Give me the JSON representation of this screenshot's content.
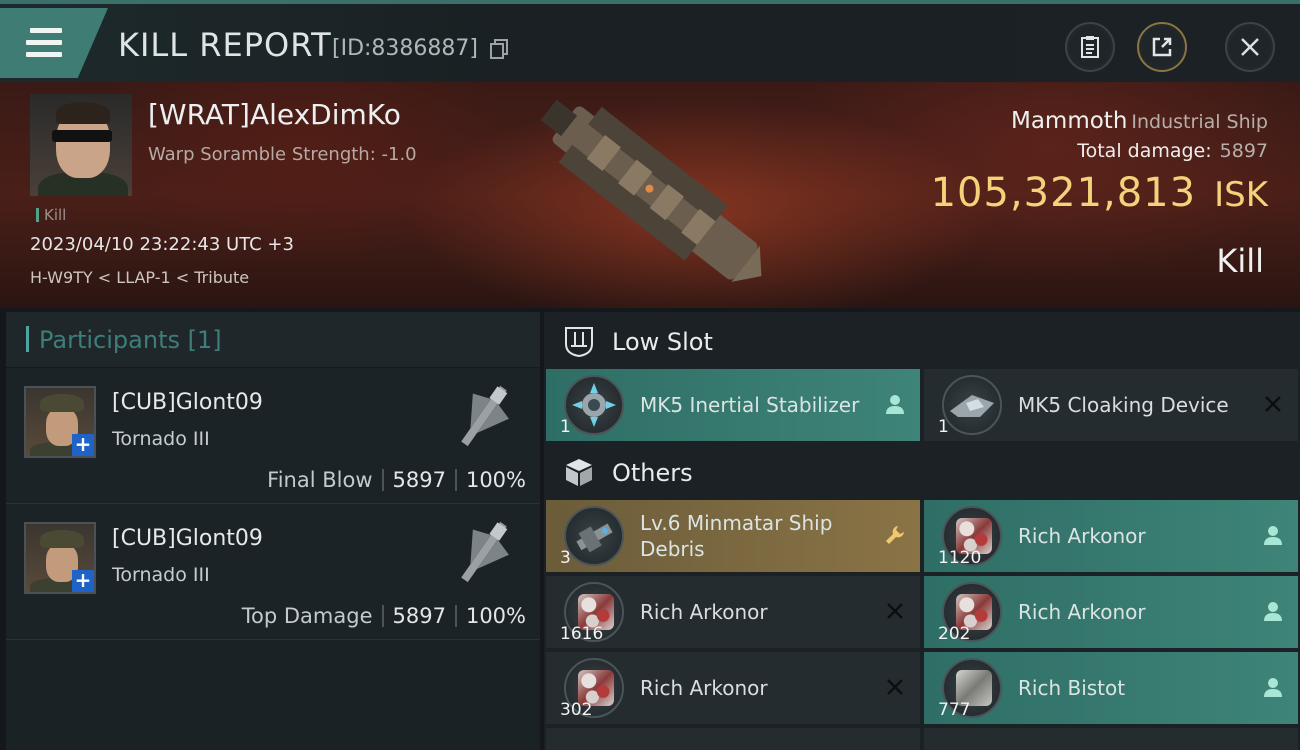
{
  "header": {
    "title": "KILL REPORT",
    "id_text": "[ID:8386887]"
  },
  "victim": {
    "name": "[WRAT]AlexDimKo",
    "warp": "Warp Soramble Strength: -1.0",
    "tag": "Kill",
    "datetime": "2023/04/10 23:22:43 UTC +3",
    "location": "H-W9TY < LLAP-1 < Tribute",
    "ship_name": "Mammoth",
    "ship_class": "Industrial Ship",
    "damage_label": "Total damage:",
    "damage_value": "5897",
    "isk_value": "105,321,813",
    "isk_unit": "ISK",
    "result": "Kill"
  },
  "participants": {
    "header": "Participants [1]",
    "rows": [
      {
        "name": "[CUB]Glont09",
        "ship": "Tornado III",
        "label": "Final Blow",
        "damage": "5897",
        "percent": "100%"
      },
      {
        "name": "[CUB]Glont09",
        "ship": "Tornado III",
        "label": "Top Damage",
        "damage": "5897",
        "percent": "100%"
      }
    ]
  },
  "fittings": {
    "low_slot": {
      "label": "Low Slot",
      "items": [
        {
          "name": "MK5 Inertial Stabilizer",
          "qty": "1",
          "state": "dropped"
        },
        {
          "name": "MK5 Cloaking Device",
          "qty": "1",
          "state": "destroyed"
        }
      ]
    },
    "others": {
      "label": "Others",
      "items": [
        {
          "name": "Lv.6 Minmatar Ship Debris",
          "qty": "3",
          "state": "salvage"
        },
        {
          "name": "Rich Arkonor",
          "qty": "1120",
          "state": "dropped"
        },
        {
          "name": "Rich Arkonor",
          "qty": "1616",
          "state": "destroyed"
        },
        {
          "name": "Rich Arkonor",
          "qty": "202",
          "state": "dropped"
        },
        {
          "name": "Rich Arkonor",
          "qty": "302",
          "state": "destroyed"
        },
        {
          "name": "Rich Bistot",
          "qty": "777",
          "state": "dropped"
        }
      ]
    }
  },
  "icons": {
    "menu": "menu-icon",
    "copy": "copy-icon",
    "report": "clipboard-icon",
    "share": "share-icon",
    "close": "close-icon",
    "dropped": "person-icon",
    "destroyed": "x-icon",
    "salvage": "wrench-icon",
    "low_slot": "low-slot-icon",
    "others": "cube-icon"
  },
  "colors": {
    "accent_teal": "#3f8478",
    "gold": "#f3d27a",
    "salvage_gold": "#8a7446"
  }
}
